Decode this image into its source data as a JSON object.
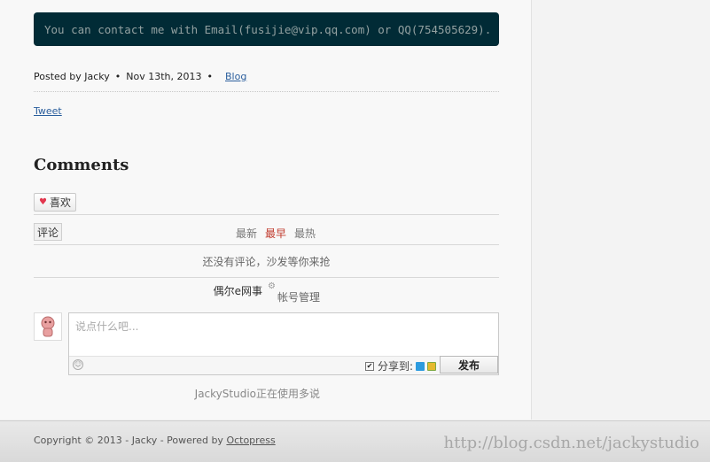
{
  "post": {
    "contact_code": "You can contact me with Email(fusijie@vip.qq.com) or QQ(754505629).",
    "posted_by": "Posted by Jacky",
    "date": "Nov 13th, 2013",
    "bullet": "•",
    "category": "Blog",
    "tweet": "Tweet"
  },
  "comments": {
    "title": "Comments",
    "like_label": "喜欢",
    "tab_label": "评论",
    "sort": {
      "newest": "最新",
      "earliest": "最早",
      "hottest": "最热",
      "active": "earliest"
    },
    "empty_message": "还没有评论，沙发等你来抢",
    "user_name": "偶尔e网事",
    "account_manage": "帐号管理",
    "input_placeholder": "说点什么吧...",
    "share_label": "分享到:",
    "share_checked": true,
    "publish_label": "发布",
    "powered_by": "JackyStudio正在使用多说"
  },
  "footer": {
    "copyright_prefix": "Copyright © 2013 - Jacky - Powered by ",
    "octopress_link": "Octopress",
    "watermark": "http://blog.csdn.net/jackystudio"
  },
  "colors": {
    "code_bg": "#012b36",
    "link": "#2a5e9d",
    "active_sort": "#c0392b",
    "heart": "#e2364d"
  },
  "icons": [
    "heart-icon",
    "gear-icon",
    "smile-icon",
    "weibo-icon",
    "qzone-icon",
    "avatar-icon"
  ]
}
